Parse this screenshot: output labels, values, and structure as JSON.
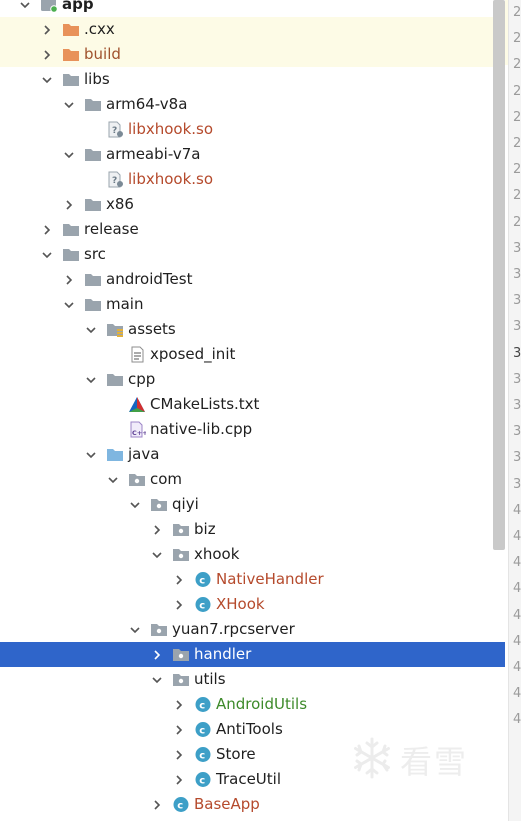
{
  "tree": [
    {
      "label": "app",
      "depth": 0,
      "expanded": true,
      "icon": "module",
      "color": "dark",
      "bold": true
    },
    {
      "label": ".cxx",
      "depth": 1,
      "expanded": false,
      "icon": "folder-orange",
      "color": "dark",
      "highlight": true
    },
    {
      "label": "build",
      "depth": 1,
      "expanded": false,
      "icon": "folder-orange",
      "color": "brown",
      "highlight": true
    },
    {
      "label": "libs",
      "depth": 1,
      "expanded": true,
      "icon": "folder-gray",
      "color": "dark"
    },
    {
      "label": "arm64-v8a",
      "depth": 2,
      "expanded": true,
      "icon": "folder-gray",
      "color": "dark"
    },
    {
      "label": "libxhook.so",
      "depth": 3,
      "icon": "file-unknown",
      "color": "red"
    },
    {
      "label": "armeabi-v7a",
      "depth": 2,
      "expanded": true,
      "icon": "folder-gray",
      "color": "dark"
    },
    {
      "label": "libxhook.so",
      "depth": 3,
      "icon": "file-unknown",
      "color": "red"
    },
    {
      "label": "x86",
      "depth": 2,
      "expanded": false,
      "icon": "folder-gray",
      "color": "dark"
    },
    {
      "label": "release",
      "depth": 1,
      "expanded": false,
      "icon": "folder-gray",
      "color": "dark"
    },
    {
      "label": "src",
      "depth": 1,
      "expanded": true,
      "icon": "folder-gray",
      "color": "dark"
    },
    {
      "label": "androidTest",
      "depth": 2,
      "expanded": false,
      "icon": "folder-gray",
      "color": "dark"
    },
    {
      "label": "main",
      "depth": 2,
      "expanded": true,
      "icon": "folder-gray",
      "color": "dark"
    },
    {
      "label": "assets",
      "depth": 3,
      "expanded": true,
      "icon": "folder-assets",
      "color": "dark"
    },
    {
      "label": "xposed_init",
      "depth": 4,
      "icon": "file-text",
      "color": "dark"
    },
    {
      "label": "cpp",
      "depth": 3,
      "expanded": true,
      "icon": "folder-gray",
      "color": "dark"
    },
    {
      "label": "CMakeLists.txt",
      "depth": 4,
      "icon": "file-cmake",
      "color": "dark"
    },
    {
      "label": "native-lib.cpp",
      "depth": 4,
      "icon": "file-cpp",
      "color": "dark"
    },
    {
      "label": "java",
      "depth": 3,
      "expanded": true,
      "icon": "folder-blue",
      "color": "dark"
    },
    {
      "label": "com",
      "depth": 4,
      "expanded": true,
      "icon": "package",
      "color": "dark"
    },
    {
      "label": "qiyi",
      "depth": 5,
      "expanded": true,
      "icon": "package",
      "color": "dark"
    },
    {
      "label": "biz",
      "depth": 6,
      "expanded": false,
      "icon": "package",
      "color": "dark"
    },
    {
      "label": "xhook",
      "depth": 6,
      "expanded": true,
      "icon": "package",
      "color": "dark"
    },
    {
      "label": "NativeHandler",
      "depth": 7,
      "expanded": false,
      "icon": "class",
      "color": "red"
    },
    {
      "label": "XHook",
      "depth": 7,
      "expanded": false,
      "icon": "class",
      "color": "red"
    },
    {
      "label": "yuan7.rpcserver",
      "depth": 5,
      "expanded": true,
      "icon": "package",
      "color": "dark"
    },
    {
      "label": "handler",
      "depth": 6,
      "expanded": false,
      "icon": "package",
      "color": "dark",
      "selected": true
    },
    {
      "label": "utils",
      "depth": 6,
      "expanded": true,
      "icon": "package",
      "color": "dark"
    },
    {
      "label": "AndroidUtils",
      "depth": 7,
      "expanded": false,
      "icon": "class",
      "color": "green"
    },
    {
      "label": "AntiTools",
      "depth": 7,
      "expanded": false,
      "icon": "class",
      "color": "dark"
    },
    {
      "label": "Store",
      "depth": 7,
      "expanded": false,
      "icon": "class",
      "color": "dark"
    },
    {
      "label": "TraceUtil",
      "depth": 7,
      "expanded": false,
      "icon": "class",
      "color": "dark"
    },
    {
      "label": "BaseApp",
      "depth": 6,
      "expanded": false,
      "icon": "class",
      "color": "red"
    }
  ],
  "gutter_lines": [
    "2",
    "2",
    "2",
    "2",
    "2",
    "2",
    "2",
    "2",
    "2",
    "3",
    "3",
    "3",
    "3",
    "3",
    "3",
    "3",
    "3",
    "3",
    "3",
    "4",
    "4",
    "4",
    "4",
    "4",
    "4",
    "4",
    "4",
    "4"
  ],
  "gutter_current_index": 13,
  "watermark_text": "看雪",
  "colors": {
    "selection": "#2f65ca",
    "highlight": "#fdfbe6",
    "class_icon": "#3d9fc7",
    "folder_orange": "#e8925a",
    "folder_gray": "#9aa4ad",
    "folder_blue": "#7fb6e0"
  }
}
